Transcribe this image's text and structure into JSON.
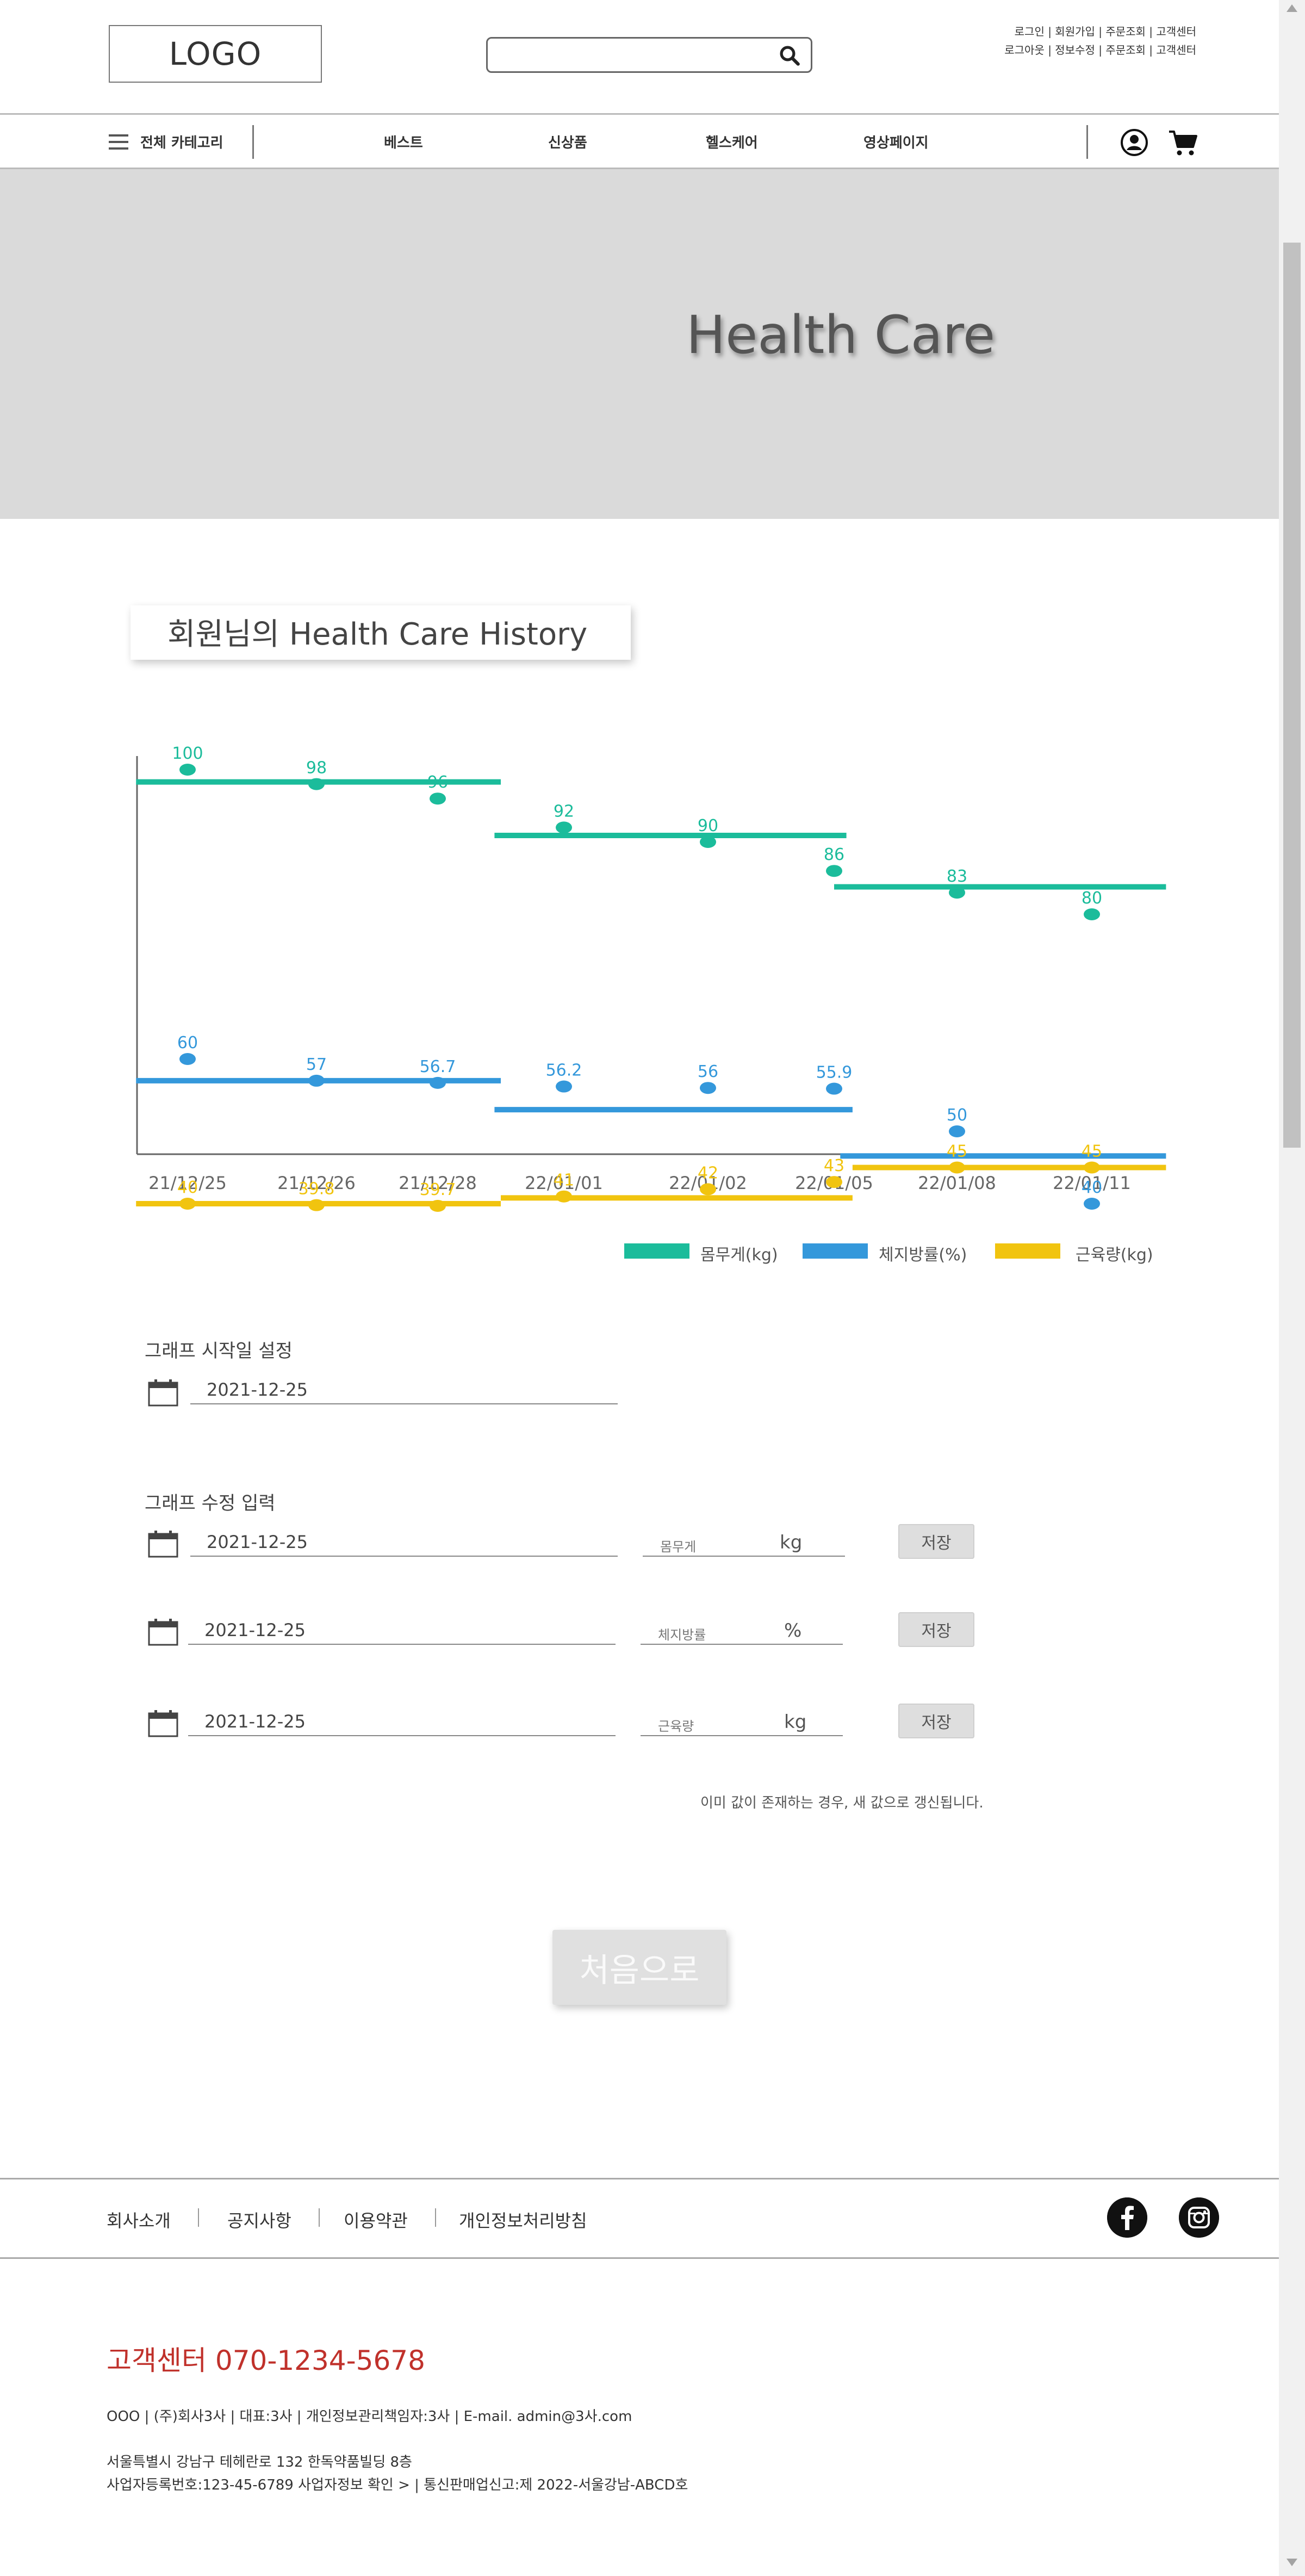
{
  "header": {
    "logo": "LOGO",
    "search_placeholder": "",
    "util_row1": "로그인 | 회원가입 | 주문조회 | 고객센터",
    "util_row2": "로그아웃 | 정보수정 | 주문조회 | 고객센터"
  },
  "nav": {
    "all_categories": "전체 카테고리",
    "items": [
      "베스트",
      "신상품",
      "헬스케어",
      "영상페이지"
    ]
  },
  "hero": {
    "title": "Health Care"
  },
  "history_title": "회원님의 Health Care History",
  "chart_data": {
    "type": "line",
    "categories": [
      "21/12/25",
      "21/12/26",
      "21/12/28",
      "22/01/01",
      "22/01/02",
      "22/01/05",
      "22/01/08",
      "22/01/11"
    ],
    "series": [
      {
        "name": "몸무게(kg)",
        "color": "#1bbc9b",
        "points": [
          [
            0,
            100
          ],
          [
            1,
            98
          ],
          [
            2,
            96
          ],
          [
            3,
            92
          ],
          [
            4,
            90
          ],
          [
            5,
            86
          ],
          [
            6,
            83
          ],
          [
            7,
            80
          ]
        ],
        "segments": [
          {
            "from": -0.4,
            "to": 2.5,
            "value": 98.3
          },
          {
            "from": 2.45,
            "to": 5.1,
            "value": 90.9
          },
          {
            "from": 5.0,
            "to": 7.55,
            "value": 83.8
          }
        ]
      },
      {
        "name": "체지방률(%)",
        "color": "#3498db",
        "points": [
          [
            0,
            60
          ],
          [
            1,
            57
          ],
          [
            2,
            56.7
          ],
          [
            3,
            56.2
          ],
          [
            4,
            56
          ],
          [
            5,
            55.9
          ],
          [
            6,
            50
          ],
          [
            7,
            40
          ]
        ],
        "segments": [
          {
            "from": -0.4,
            "to": 2.5,
            "value": 57.0
          },
          {
            "from": 2.45,
            "to": 5.15,
            "value": 53.0
          },
          {
            "from": 5.05,
            "to": 7.55,
            "value": 46.6
          }
        ]
      },
      {
        "name": "근육량(kg)",
        "color": "#f1c40f",
        "points": [
          [
            0,
            40
          ],
          [
            1,
            39.8
          ],
          [
            2,
            39.7
          ],
          [
            3,
            41
          ],
          [
            4,
            42
          ],
          [
            5,
            43
          ],
          [
            6,
            45
          ],
          [
            7,
            45
          ]
        ],
        "segments": [
          {
            "from": -0.4,
            "to": 2.5,
            "value": 40.0
          },
          {
            "from": 2.5,
            "to": 5.15,
            "value": 40.8
          },
          {
            "from": 5.15,
            "to": 7.55,
            "value": 45.0
          }
        ]
      }
    ],
    "point_labels": [
      [
        "100",
        "98",
        "96",
        "92",
        "90",
        "86",
        "83",
        "80"
      ],
      [
        "60",
        "57",
        "56.7",
        "56.2",
        "56",
        "55.9",
        "50",
        "40"
      ],
      [
        "40",
        "39.8",
        "39.7",
        "41",
        "42",
        "43",
        "45",
        "45"
      ]
    ],
    "ylim": [
      20,
      103
    ],
    "grid": false,
    "legend_position": "bottom-right"
  },
  "legend": [
    "몸무게(kg)",
    "체지방률(%)",
    "근육량(kg)"
  ],
  "start_section": {
    "label": "그래프 시작일 설정",
    "date": "2021-12-25"
  },
  "edit_section": {
    "label": "그래프 수정 입력",
    "rows": [
      {
        "date": "2021-12-25",
        "field_label": "몸무게",
        "unit": "kg",
        "button": "저장"
      },
      {
        "date": "2021-12-25",
        "field_label": "체지방률",
        "unit": "%",
        "button": "저장"
      },
      {
        "date": "2021-12-25",
        "field_label": "근육량",
        "unit": "kg",
        "button": "저장"
      }
    ],
    "note": "이미 값이 존재하는 경우, 새 값으로 갱신됩니다."
  },
  "home_button": "처음으로",
  "footer": {
    "links": [
      "회사소개",
      "공지사항",
      "이용약관",
      "개인정보처리방침"
    ],
    "customer_center": "고객센터  070-1234-5678",
    "info1": "OOO | (주)회사3사 | 대표:3사 | 개인정보관리책임자:3사 | E-mail. admin@3사.com",
    "info2": "서울특별시 강남구 테헤란로 132 한독약품빌딩 8층",
    "info3": "사업자등록번호:123-45-6789 사업자정보 확인 > | 통신판매업신고:제 2022-서울강남-ABCD호"
  },
  "icons": {
    "search": "search-icon",
    "menu": "menu-icon",
    "user": "user-icon",
    "cart": "cart-icon",
    "calendar": "calendar-icon",
    "facebook": "facebook-icon",
    "instagram": "instagram-icon"
  }
}
